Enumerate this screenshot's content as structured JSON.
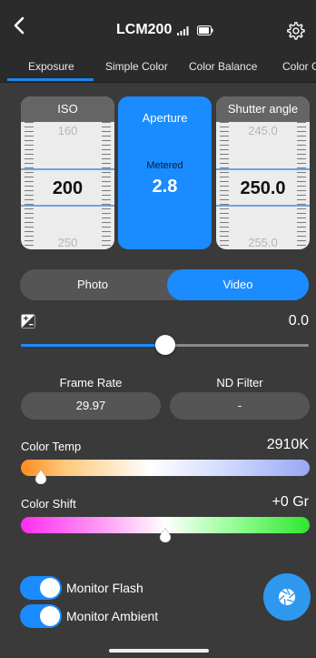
{
  "header": {
    "title": "LCM200",
    "icons": [
      "back-icon",
      "signal-icon",
      "battery-icon",
      "gear-icon"
    ]
  },
  "tabs": [
    {
      "label": "Exposure",
      "active": true
    },
    {
      "label": "Simple Color",
      "active": false
    },
    {
      "label": "Color Balance",
      "active": false
    },
    {
      "label": "Color G",
      "active": false
    }
  ],
  "dials": {
    "iso": {
      "label": "ISO",
      "prev": "160",
      "value": "200",
      "next": "250"
    },
    "aperture": {
      "label": "Aperture",
      "sub": "Metered",
      "value": "2.8"
    },
    "shutter": {
      "label": "Shutter angle",
      "prev": "245.0",
      "value": "250.0",
      "next": "255.0"
    }
  },
  "mode": {
    "options": [
      "Photo",
      "Video"
    ],
    "selected": "Video"
  },
  "exposure_comp": {
    "value_text": "0.0",
    "slider_fraction": 0.5
  },
  "frame_rate": {
    "label": "Frame Rate",
    "value": "29.97"
  },
  "nd_filter": {
    "label": "ND Filter",
    "value": "-"
  },
  "color_temp": {
    "label": "Color Temp",
    "value": "2910K",
    "slider_fraction": 0.07
  },
  "color_shift": {
    "label": "Color Shift",
    "value": "+0 Gr",
    "slider_fraction": 0.5
  },
  "toggles": [
    {
      "label": "Monitor Flash",
      "on": true
    },
    {
      "label": "Monitor Ambient",
      "on": true
    }
  ],
  "colors": {
    "accent": "#1a8cff",
    "background": "#3a3a3a"
  }
}
